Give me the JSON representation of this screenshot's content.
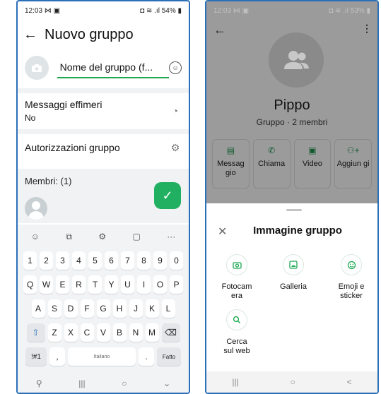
{
  "left": {
    "status": {
      "time": "12:03 ⋈ ▣",
      "battery": "◘ ≋ .ıl 54% ▮"
    },
    "app_bar": {
      "title": "Nuovo gruppo"
    },
    "group_name_value": "Nome del gruppo (f...",
    "settings": [
      {
        "title": "Messaggi effimeri",
        "subtitle": "No"
      },
      {
        "title": "Autorizzazioni gruppo",
        "subtitle": ""
      }
    ],
    "members_label": "Membri: (1)",
    "keyboard": {
      "toolbar": [
        "☺",
        "⧉",
        "⚙",
        "▢",
        "···"
      ],
      "rows": [
        [
          "1",
          "2",
          "3",
          "4",
          "5",
          "6",
          "7",
          "8",
          "9",
          "0"
        ],
        [
          "Q",
          "W",
          "E",
          "R",
          "T",
          "Y",
          "U",
          "I",
          "O",
          "P"
        ],
        [
          "A",
          "S",
          "D",
          "F",
          "G",
          "H",
          "J",
          "K",
          "L"
        ],
        [
          "⇧",
          "Z",
          "X",
          "C",
          "V",
          "B",
          "N",
          "M",
          "⌫"
        ]
      ],
      "bottom": {
        "symbols": "!#1",
        "comma": ",",
        "space": "Italiano",
        "period": ".",
        "done": "Fatto"
      },
      "nav": [
        "⚲",
        "|||",
        "○",
        "⌄"
      ]
    }
  },
  "right": {
    "status": {
      "time": "12:03 ⋈ ▣",
      "battery": "◘ ≋ .ıl 53% ▮"
    },
    "name": "Pippo",
    "subtitle": "Gruppo · 2 membri",
    "actions": [
      {
        "label": "Messag gio",
        "icon": "message-icon"
      },
      {
        "label": "Chiama",
        "icon": "phone-icon"
      },
      {
        "label": "Video",
        "icon": "video-icon"
      },
      {
        "label": "Aggiun gi",
        "icon": "add-person-icon"
      }
    ],
    "sheet": {
      "title": "Immagine gruppo",
      "options": [
        {
          "label": "Fotocam era",
          "icon": "camera-icon"
        },
        {
          "label": "Galleria",
          "icon": "gallery-icon"
        },
        {
          "label": "Emoji e sticker",
          "icon": "emoji-sticker-icon"
        },
        {
          "label": "Cerca sul web",
          "icon": "search-icon"
        }
      ]
    },
    "nav": [
      "|||",
      "○",
      "<"
    ]
  },
  "colors": {
    "accent": "#1da851",
    "fab": "#21b061",
    "dim": "#9b9b9b",
    "frame": "#2a6fb8"
  }
}
